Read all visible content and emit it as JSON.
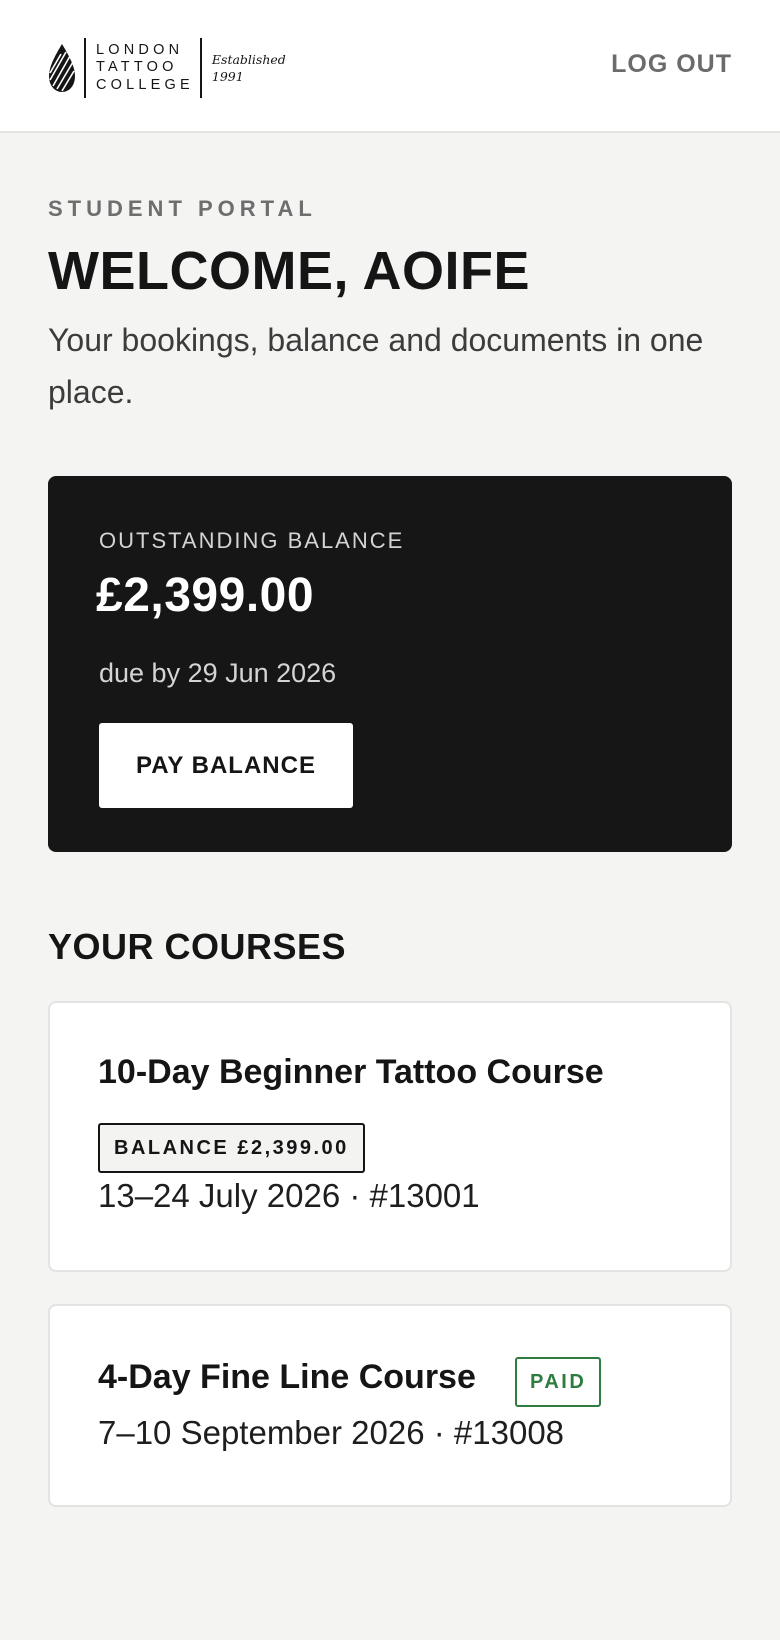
{
  "header": {
    "logo": {
      "name_lines": [
        "LONDON",
        "TATTOO",
        "COLLEGE"
      ],
      "established_lines": [
        "Established",
        "1991"
      ]
    },
    "logout_label": "LOG OUT"
  },
  "intro": {
    "eyebrow": "STUDENT PORTAL",
    "welcome": "WELCOME, AOIFE",
    "subtitle": "Your bookings, balance and documents in one place."
  },
  "balance": {
    "label": "OUTSTANDING BALANCE",
    "amount": "£2,399.00",
    "due": "due by 29 Jun 2026",
    "pay_button": "PAY BALANCE"
  },
  "courses": {
    "title": "YOUR COURSES",
    "items": [
      {
        "name": "10-Day Beginner Tattoo Course",
        "badge": "BALANCE £2,399.00",
        "meta": "13–24 July 2026 · #13001"
      },
      {
        "name": "4-Day Fine Line Course",
        "badge": "PAID",
        "meta": "7–10 September 2026 · #13008"
      }
    ]
  },
  "colors": {
    "page_bg": "#f4f4f3",
    "card_dark": "#161616",
    "paid_green": "#2e7d3f",
    "muted_text": "#6e6e6e"
  }
}
